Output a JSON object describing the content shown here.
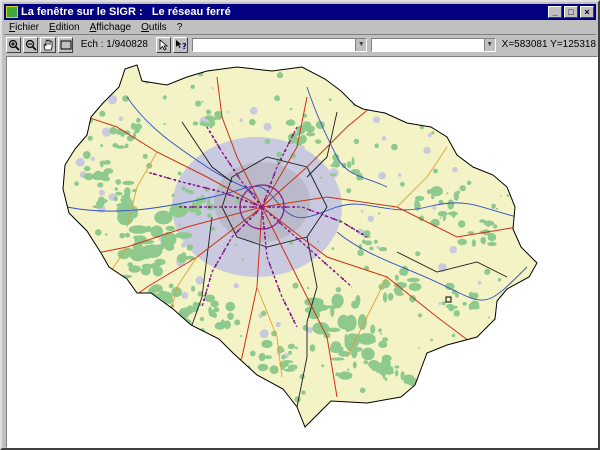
{
  "window": {
    "title": "La fenêtre sur le SIGR :   Le réseau ferré",
    "buttons": {
      "minimize": "_",
      "maximize": "□",
      "close": "×"
    }
  },
  "menu": {
    "items": [
      "Fichier",
      "Edition",
      "Affichage",
      "Outils",
      "?"
    ]
  },
  "toolbar": {
    "tools": [
      "zoom-in-icon",
      "zoom-out-icon",
      "pan-hand-icon",
      "extent-rect-icon"
    ],
    "scale_label": "Ech : 1/940828",
    "select_tool": "arrow-pointer-icon",
    "help_tool": "query-help-icon",
    "combo1_value": "",
    "combo2_value": "",
    "coords": "X=583081  Y=125318"
  },
  "map": {
    "colors": {
      "territory": "#f3f3c6",
      "forest": "#8ec98e",
      "urban": "#c9c9e0",
      "dense_urban": "#b9b9c9",
      "border": "#000000",
      "rail_main": "#d03010",
      "rail_suburban": "#8a1a8a",
      "rail_other": "#e0a030",
      "river": "#3050c0"
    }
  }
}
